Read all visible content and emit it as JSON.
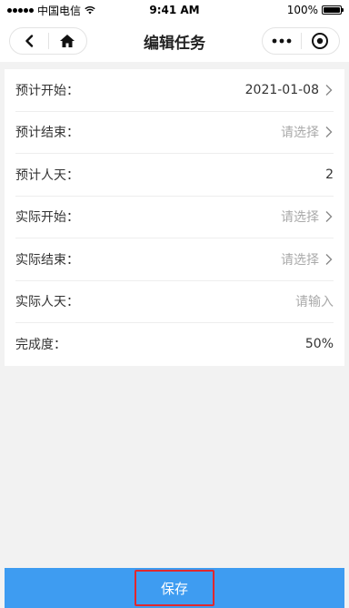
{
  "status_bar": {
    "carrier": "中国电信",
    "time": "9:41 AM",
    "battery": "100%"
  },
  "nav": {
    "title": "编辑任务"
  },
  "form": {
    "rows": [
      {
        "label": "预计开始：",
        "value": "2021-01-08",
        "placeholder": false,
        "chevron": true
      },
      {
        "label": "预计结束：",
        "value": "请选择",
        "placeholder": true,
        "chevron": true
      },
      {
        "label": "预计人天：",
        "value": "2",
        "placeholder": false,
        "chevron": false
      },
      {
        "label": "实际开始：",
        "value": "请选择",
        "placeholder": true,
        "chevron": true
      },
      {
        "label": "实际结束：",
        "value": "请选择",
        "placeholder": true,
        "chevron": true
      },
      {
        "label": "实际人天：",
        "value": "请输入",
        "placeholder": true,
        "chevron": false
      },
      {
        "label": "完成度：",
        "value": "50%",
        "placeholder": false,
        "chevron": false
      }
    ]
  },
  "footer": {
    "save_label": "保存"
  },
  "colors": {
    "accent": "#3e9cf1",
    "highlight_border": "#e0282e"
  }
}
